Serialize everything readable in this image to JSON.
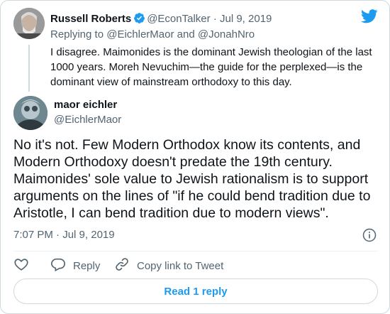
{
  "parent_tweet": {
    "author_name": "Russell Roberts",
    "handle": "@EconTalker",
    "separator": "·",
    "date": "Jul 9, 2019",
    "replying_prefix": "Replying to",
    "replying_mention_1": "@EichlerMaor",
    "replying_and": "and",
    "replying_mention_2": "@JonahNro",
    "text": "I disagree. Maimonides is the dominant Jewish theologian of the last 1000 years. Moreh Nevuchim—the guide for the perplexed—is the dominant view of mainstream orthodoxy to this day."
  },
  "tweet": {
    "author_name": "maor eichler",
    "handle": "@EichlerMaor",
    "text": "No it's not. Few Modern Orthodox know its contents, and Modern Orthodoxy doesn't predate the 19th century. Maimonides' sole value to Jewish rationalism is to support arguments on the lines of \"if he could bend tradition due to Aristotle, I can bend tradition due to modern views\".",
    "time": "7:07 PM",
    "separator": "·",
    "date": "Jul 9, 2019"
  },
  "actions": {
    "reply_label": "Reply",
    "copy_link_label": "Copy link to Tweet"
  },
  "read_replies_label": "Read 1 reply",
  "colors": {
    "accent": "#1d9bf0",
    "muted_text": "#536471",
    "border": "#cfd9de",
    "like_red": "#f91880"
  },
  "icons": [
    "verified-badge-icon",
    "twitter-bird-icon",
    "info-icon",
    "heart-icon",
    "reply-icon",
    "link-icon"
  ]
}
